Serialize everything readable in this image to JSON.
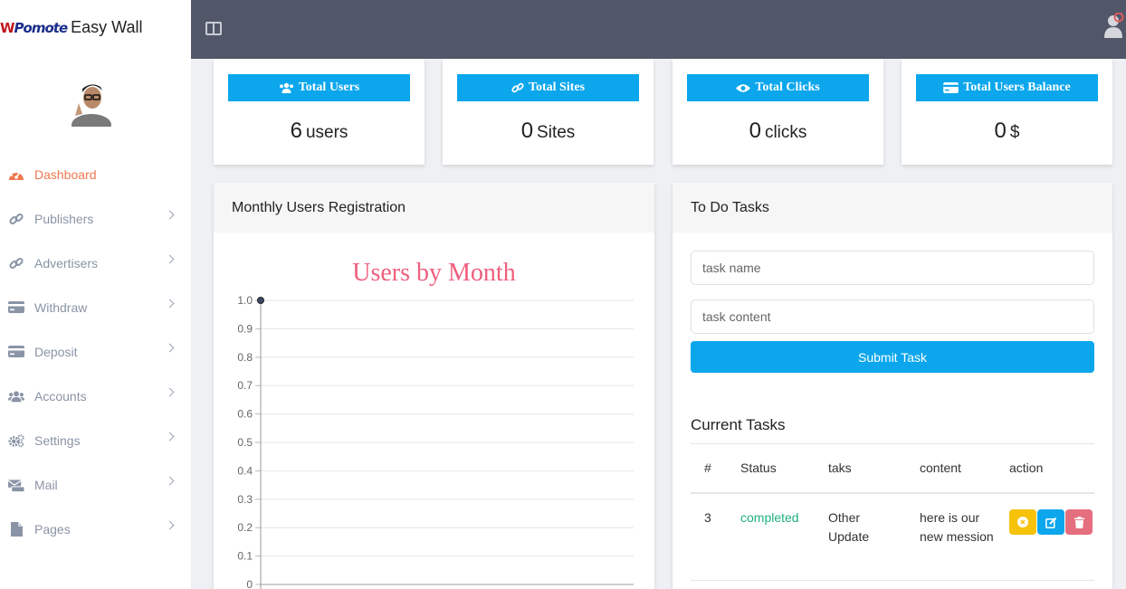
{
  "brand": {
    "logo": "WPomote",
    "logo_w": "W",
    "logo_rest": "Pomote",
    "name": "Easy Wall"
  },
  "sidebar": {
    "items": [
      {
        "label": "Dashboard",
        "icon": "tachometer-icon",
        "active": true
      },
      {
        "label": "Publishers",
        "icon": "link-icon"
      },
      {
        "label": "Advertisers",
        "icon": "link-icon"
      },
      {
        "label": "Withdraw",
        "icon": "credit-card-icon"
      },
      {
        "label": "Deposit",
        "icon": "credit-card-icon"
      },
      {
        "label": "Accounts",
        "icon": "users-icon"
      },
      {
        "label": "Settings",
        "icon": "cogs-icon"
      },
      {
        "label": "Mail",
        "icon": "mail-icon"
      },
      {
        "label": "Pages",
        "icon": "file-icon"
      }
    ]
  },
  "stats": [
    {
      "title": "Total Users",
      "value": "6",
      "unit": "users",
      "icon": "users-icon"
    },
    {
      "title": "Total Sites",
      "value": "0",
      "unit": "Sites",
      "icon": "link-icon"
    },
    {
      "title": "Total Clicks",
      "value": "0",
      "unit": "clicks",
      "icon": "eye-icon"
    },
    {
      "title": "Total Users Balance",
      "value": "0",
      "unit": "$",
      "icon": "credit-card-icon"
    }
  ],
  "chart_panel": {
    "title": "Monthly Users Registration"
  },
  "chart_data": {
    "type": "line",
    "title": "Users by Month",
    "ylim": [
      0,
      1.0
    ],
    "yticks": [
      "1.0",
      "0.9",
      "0.8",
      "0.7",
      "0.6",
      "0.5",
      "0.4",
      "0.3",
      "0.2",
      "0.1",
      "0"
    ],
    "series": [
      {
        "values": [
          1.0
        ]
      }
    ],
    "grid": true
  },
  "todo": {
    "title": "To Do Tasks",
    "name_placeholder": "task name",
    "content_placeholder": "task content",
    "submit_label": "Submit Task",
    "current_title": "Current Tasks",
    "columns": [
      "#",
      "Status",
      "taks",
      "content",
      "action"
    ],
    "rows": [
      {
        "id": "3",
        "status": "completed",
        "task": "Other Update",
        "content": "here is our new mession"
      }
    ]
  },
  "colors": {
    "accent": "#0ba6ec",
    "active_nav": "#f0784f",
    "topbar": "#515768",
    "chart_title": "#ee5f7d",
    "status": "#1fb17c"
  }
}
